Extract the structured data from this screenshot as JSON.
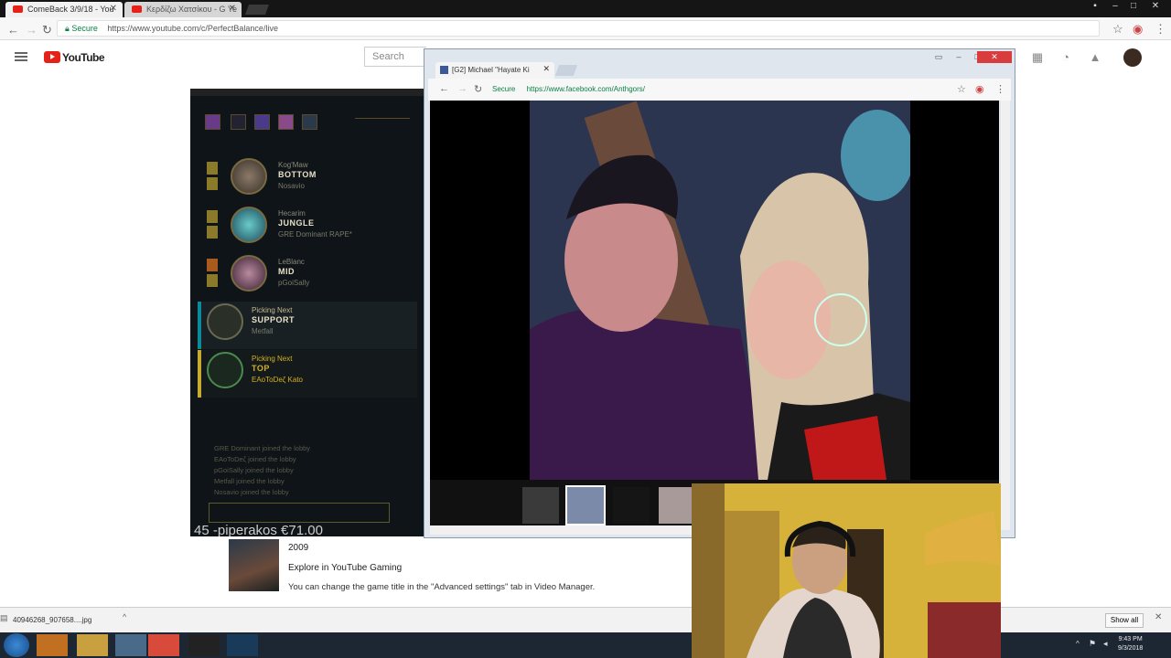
{
  "outer_browser": {
    "tabs": [
      {
        "label": "ComeBack 3/9/18 - You",
        "active": true
      },
      {
        "label": "Κερδίζω Χατσίκου - G Ye",
        "active": false
      }
    ],
    "secure_label": "Secure",
    "url": "https://www.youtube.com/c/PerfectBalance/live"
  },
  "youtube": {
    "brand": "YouTube",
    "search_placeholder": "Search"
  },
  "game_client": {
    "slots": [
      {
        "champion": "Kog'Maw",
        "role": "BOTTOM",
        "player": "Nosavio"
      },
      {
        "champion": "Hecarim",
        "role": "JUNGLE",
        "player": "GRE Dominant RAPE*"
      },
      {
        "champion": "LeBlanc",
        "role": "MID",
        "player": "pGoiSally"
      },
      {
        "champion": "Picking Next",
        "role": "SUPPORT",
        "player": "Metfall"
      },
      {
        "champion": "Picking Next",
        "role": "TOP",
        "player": "EAoToDeζ Kato"
      }
    ],
    "lobby_log": [
      "GRE Dominant joined the lobby",
      "EAoToDeζ joined the lobby",
      "pGoiSally joined the lobby",
      "Metfall joined the lobby",
      "Nosavio joined the lobby"
    ],
    "overlay_text": "45 -piperakos €71.00"
  },
  "popup": {
    "tab_label": "[G2] Michael \"Hayate Ki",
    "secure_label": "Secure",
    "url": "https://www.facebook.com/Anthgors/"
  },
  "video_meta": {
    "year": "2009",
    "explore_label": "Explore in YouTube Gaming",
    "warning": "You can change the game title in the \"Advanced settings\" tab in Video Manager."
  },
  "downloads": {
    "file_name": "40946268_907658....jpg",
    "show_all": "Show all"
  },
  "taskbar": {
    "time": "9:43 PM",
    "date": "9/3/2018"
  }
}
